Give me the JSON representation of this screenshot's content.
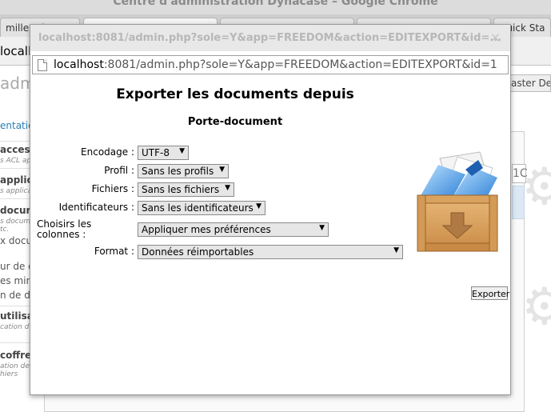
{
  "browser": {
    "window_title": "Centre d'administration Dynacase – Google Chrome",
    "tabs": [
      {
        "label": "mille - d"
      },
      {
        "label": ""
      },
      {
        "label": ""
      },
      {
        "label": ""
      },
      {
        "label": "Quick Sta"
      }
    ],
    "url_fragment": "locall"
  },
  "background_page": {
    "heading_fragment": "adm",
    "sidebar_link": "entation",
    "sidebar_items": [
      {
        "title": "acces",
        "subtitle": "s ACL ap"
      },
      {
        "title": "applic",
        "subtitle": "s applica"
      },
      {
        "title": "docur",
        "subtitle": "s docume"
      },
      {
        "title": "utilisa",
        "subtitle": "cation d"
      },
      {
        "title": "coffre",
        "subtitle": "ation des"
      }
    ],
    "sidebar_extra_1": "tc.",
    "sidebar_extra_2": "x docu",
    "sidebar_text_lines": [
      "ur de d",
      "es min",
      "n de de"
    ],
    "sidebar_extra_3": "hiers",
    "right_button": "aster Def",
    "right_field": "1C"
  },
  "popup": {
    "title": "localhost:8081/admin.php?sole=Y&app=FREEDOM&action=EDITEXPORT&id=...",
    "url_host": "localhost",
    "url_rest": ":8081/admin.php?sole=Y&app=FREEDOM&action=EDITEXPORT&id=1",
    "close_glyph": "×",
    "heading": "Exporter les documents depuis",
    "subheading": "Porte-document",
    "form": {
      "encodage_label": "Encodage :",
      "encodage_value": "UTF-8",
      "profil_label": "Profil :",
      "profil_value": "Sans les profils",
      "fichiers_label": "Fichiers :",
      "fichiers_value": "Sans les fichiers",
      "identificateurs_label": "Identificateurs :",
      "identificateurs_value": "Sans les identificateurs",
      "colonnes_label": "Choisirs les colonnes :",
      "colonnes_value": "Appliquer mes préférences",
      "format_label": "Format :",
      "format_value": "Données réimportables"
    },
    "export_button": "Exporter",
    "dropdown_arrow": "▼"
  }
}
